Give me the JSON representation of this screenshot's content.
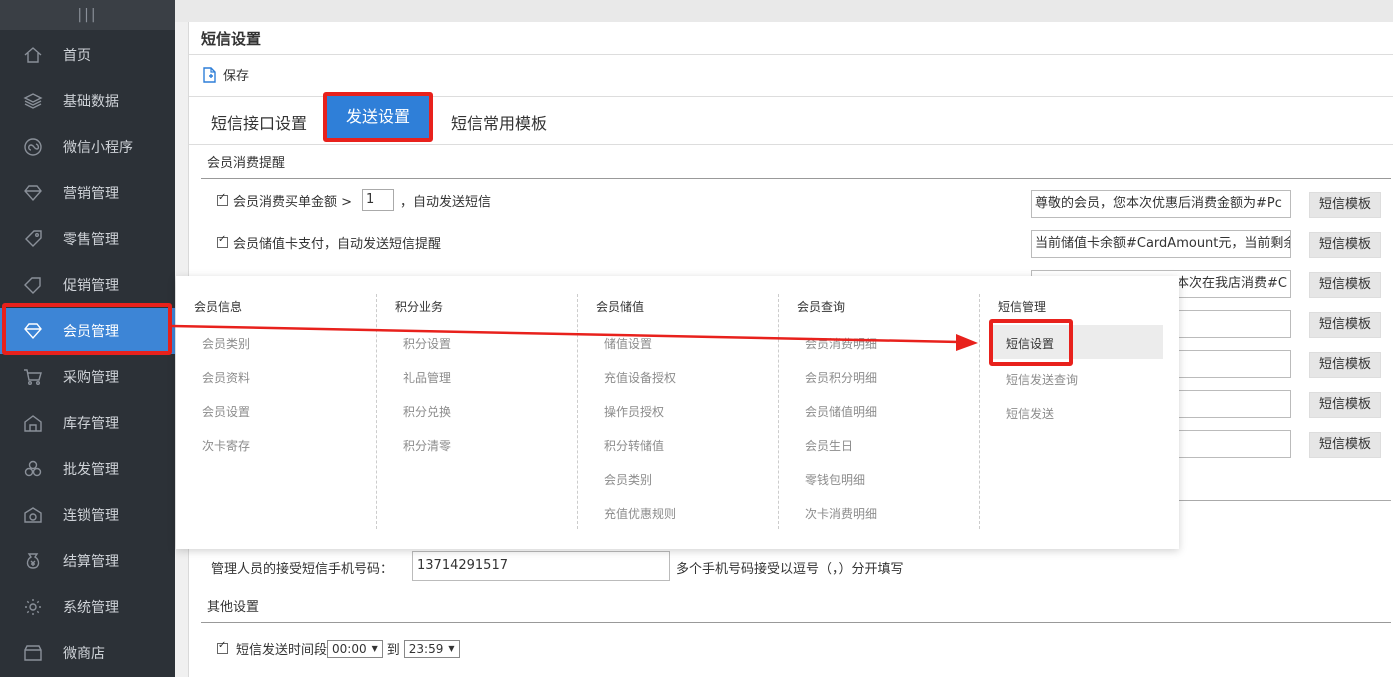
{
  "sidebar": {
    "handle": "|||",
    "items": [
      {
        "label": "首页",
        "icon": "home-icon"
      },
      {
        "label": "基础数据",
        "icon": "layers-icon"
      },
      {
        "label": "微信小程序",
        "icon": "miniprogram-icon"
      },
      {
        "label": "营销管理",
        "icon": "diamond-icon"
      },
      {
        "label": "零售管理",
        "icon": "tag-icon"
      },
      {
        "label": "促销管理",
        "icon": "promo-icon"
      },
      {
        "label": "会员管理",
        "icon": "member-icon",
        "active": true
      },
      {
        "label": "采购管理",
        "icon": "cart-icon"
      },
      {
        "label": "库存管理",
        "icon": "warehouse-icon"
      },
      {
        "label": "批发管理",
        "icon": "boxes-icon"
      },
      {
        "label": "连锁管理",
        "icon": "chain-icon"
      },
      {
        "label": "结算管理",
        "icon": "money-bag-icon"
      },
      {
        "label": "系统管理",
        "icon": "gear-icon"
      },
      {
        "label": "微商店",
        "icon": "shop-icon"
      }
    ]
  },
  "page": {
    "title": "短信设置",
    "save_label": "保存",
    "tabs": [
      "短信接口设置",
      "发送设置",
      "短信常用模板"
    ],
    "active_tab": "发送设置"
  },
  "consumption": {
    "section_title": "会员消费提醒",
    "row1_prefix": "会员消费买单金额 >",
    "row1_value": "1",
    "row1_suffix": "，自动发送短信",
    "row2": "会员储值卡支付，自动发送短信提醒",
    "templates": [
      "尊敬的会员，您本次优惠后消费金额为#Pc",
      "当前储值卡余额#CardAmount元，当前剩余",
      "本次在我店消费#C",
      "",
      "",
      "",
      ""
    ],
    "template_button": "短信模板"
  },
  "admin": {
    "phone_label": "管理人员的接受短信手机号码：",
    "phone_value": "13714291517",
    "phone_note": "多个手机号码接受以逗号（，）分开填写"
  },
  "other": {
    "section_title": "其他设置",
    "time_label": "短信发送时间段",
    "time_from": "00:00",
    "time_to_label": "到",
    "time_to": "23:59"
  },
  "mega_menu": {
    "columns": [
      {
        "title": "会员信息",
        "items": [
          "会员类别",
          "会员资料",
          "会员设置",
          "次卡寄存"
        ]
      },
      {
        "title": "积分业务",
        "items": [
          "积分设置",
          "礼品管理",
          "积分兑换",
          "积分清零"
        ]
      },
      {
        "title": "会员储值",
        "items": [
          "储值设置",
          "充值设备授权",
          "操作员授权",
          "积分转储值",
          "会员类别",
          "充值优惠规则"
        ]
      },
      {
        "title": "会员查询",
        "items": [
          "会员消费明细",
          "会员积分明细",
          "会员储值明细",
          "会员生日",
          "零钱包明细",
          "次卡消费明细"
        ]
      },
      {
        "title": "短信管理",
        "items": [
          "短信设置",
          "短信发送查询",
          "短信发送"
        ]
      }
    ],
    "highlighted": "短信设置"
  },
  "colors": {
    "sidebar_bg": "#2c3137",
    "accent": "#3d85d6",
    "annotation_red": "#e8211c"
  }
}
